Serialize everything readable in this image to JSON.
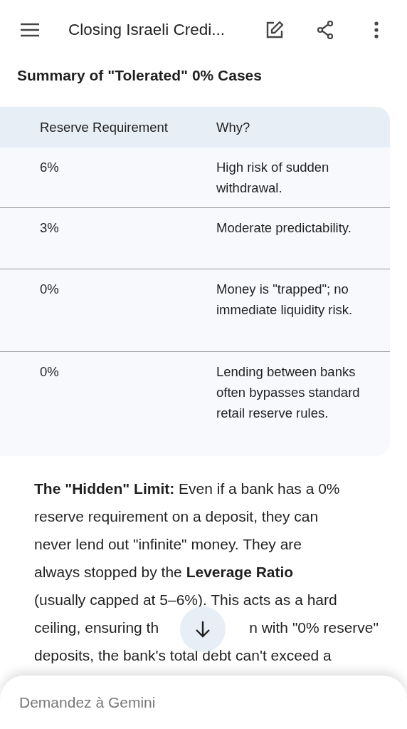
{
  "top_bar": {
    "title": "Closing Israeli Credi..."
  },
  "section_heading": "Summary of \"Tolerated\" 0% Cases",
  "table": {
    "columns": [
      "Reserve Requirement",
      "Why?"
    ],
    "rows": [
      [
        "6%",
        "High risk of sudden withdrawal."
      ],
      [
        "3%",
        "Moderate predictability."
      ],
      [
        "0%",
        "Money is \"trapped\"; no immediate liquidity risk."
      ],
      [
        "0%",
        "Lending between banks often bypasses standard retail reserve rules."
      ]
    ]
  },
  "paragraph_lines": [
    [
      "**The \"Hidden\" Limit:** Even if a bank has a 0%"
    ],
    [
      "reserve requirement on a deposit, they can"
    ],
    [
      "never lend out \"infinite\" money. They are"
    ],
    [
      "always stopped by the **Leverage Ratio**"
    ],
    [
      "(usually capped at 5–6%). This acts as a hard"
    ],
    [
      "ceiling, ensuring th",
      "n with \"0% reserve\""
    ],
    [
      "deposits, the bank's total debt can't exceed a"
    ]
  ],
  "prompt_field": {
    "placeholder": "Demandez à Gemini"
  }
}
